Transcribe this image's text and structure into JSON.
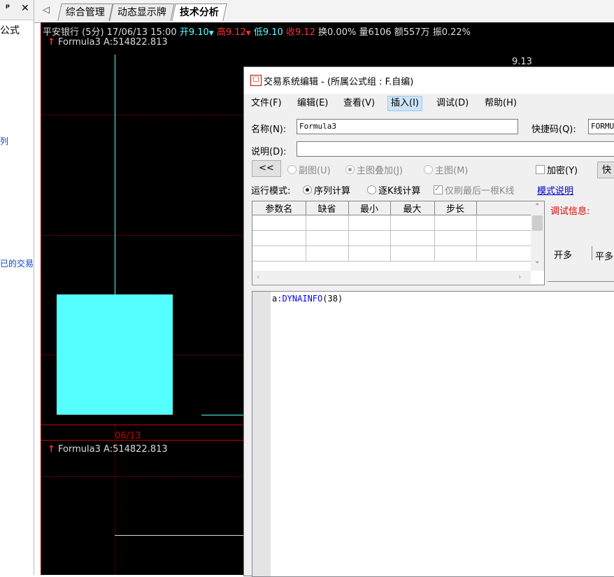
{
  "left_panel": {
    "header_pin": "ᵖ",
    "header_close": "✕",
    "title": "公式",
    "item1": "列",
    "item2": "已的交易"
  },
  "tabs": {
    "nav": "◁",
    "items": [
      {
        "label": "综合管理"
      },
      {
        "label": "动态显示牌"
      },
      {
        "label": "技术分析"
      }
    ]
  },
  "chart": {
    "stock": "平安银行 (5分) 17/06/13 15:00",
    "open_label": "开9.10",
    "high_label": "高9.12",
    "low_label": "低9.10",
    "close_label": "收9.12",
    "turnover": "换0.00%",
    "volume": "量6106",
    "amount": "额557万",
    "amplitude": "振0.22%",
    "formula_main": "Formula3",
    "formula_main_value": "A:514822.813",
    "price_label": "9.13",
    "date_label": "06/13",
    "formula_sub": "Formula3",
    "formula_sub_value": "A:514822.813",
    "colors": {
      "up": "#ff3030",
      "down": "#54ffff",
      "text": "#dcdcdc",
      "grid": "#9a0000"
    }
  },
  "dialog": {
    "title": "交易系统编辑 - (所属公式组 : F.自编)",
    "menu": [
      {
        "label": "文件(F)"
      },
      {
        "label": "编辑(E)"
      },
      {
        "label": "查看(V)"
      },
      {
        "label": "插入(I)"
      },
      {
        "label": "调试(D)"
      },
      {
        "label": "帮助(H)"
      }
    ],
    "name_label": "名称(N):",
    "name_value": "Formula3",
    "shortcut_label": "快捷码(Q):",
    "shortcut_value": "FORMU",
    "desc_label": "说明(D):",
    "desc_value": "",
    "back_btn": "<<",
    "radio_sub": "副图(U)",
    "radio_overlay": "主图叠加(J)",
    "radio_main": "主图(M)",
    "encrypt_label": "加密(Y)",
    "quick_btn": "快",
    "run_mode_label": "运行模式:",
    "mode_seq": "序列计算",
    "mode_tick": "逐K线计算",
    "refresh_last": "仅刷最后一根K线",
    "mode_link": "模式说明",
    "params_headers": [
      "参数名",
      "缺省",
      "最小",
      "最大",
      "步长"
    ],
    "debug_label": "调试信息:",
    "tab_open_long": "开多",
    "tab_close_long": "平多",
    "code_var": "a",
    "code_rest": ":DYNAINFO",
    "code_args": "(38)"
  }
}
